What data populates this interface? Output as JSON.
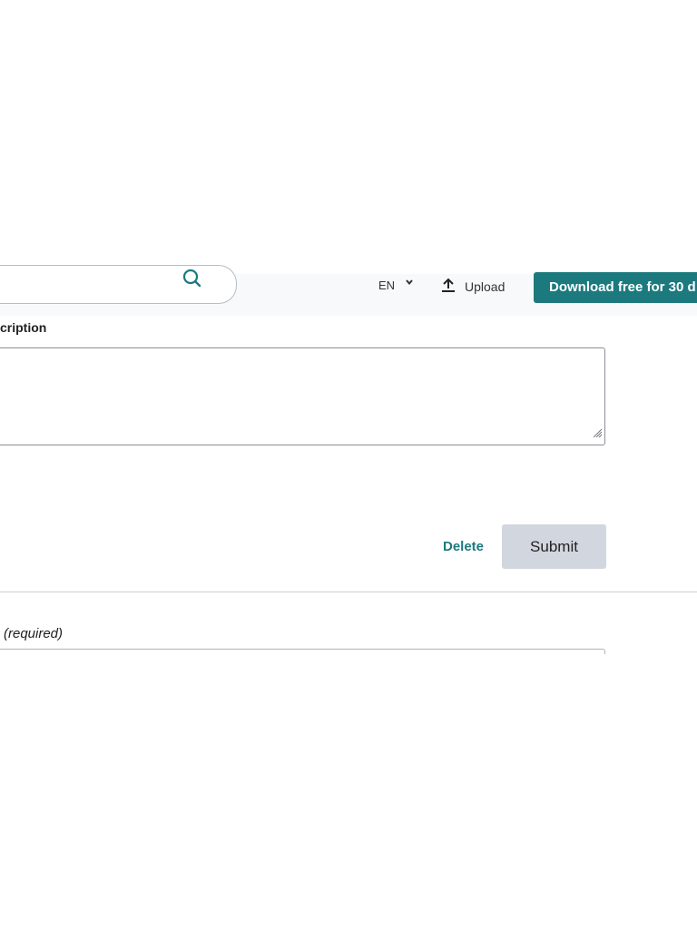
{
  "header": {
    "language": "EN",
    "upload_label": "Upload",
    "download_button": "Download free for 30 d"
  },
  "form": {
    "description_label": "cription",
    "description_value": "",
    "delete_label": "Delete",
    "submit_label": "Submit",
    "required_label": "(required)"
  },
  "colors": {
    "accent": "#1c7a7e",
    "submit_bg": "#d2d6de"
  }
}
